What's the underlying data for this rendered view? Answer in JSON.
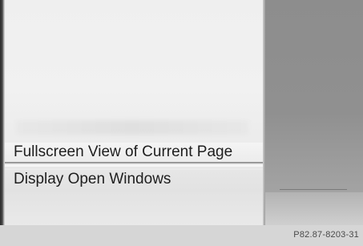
{
  "menu": {
    "items": [
      {
        "label": "Fullscreen View of Current Page",
        "selected": true
      },
      {
        "label": "Display Open Windows",
        "selected": false
      }
    ]
  },
  "caption": {
    "code": "P82.87-8203-31"
  },
  "colors": {
    "menu_background": "#efefef",
    "right_panel": "#8d8d8d",
    "text": "#1e1e1e",
    "caption_bar": "#d6d6d6"
  }
}
